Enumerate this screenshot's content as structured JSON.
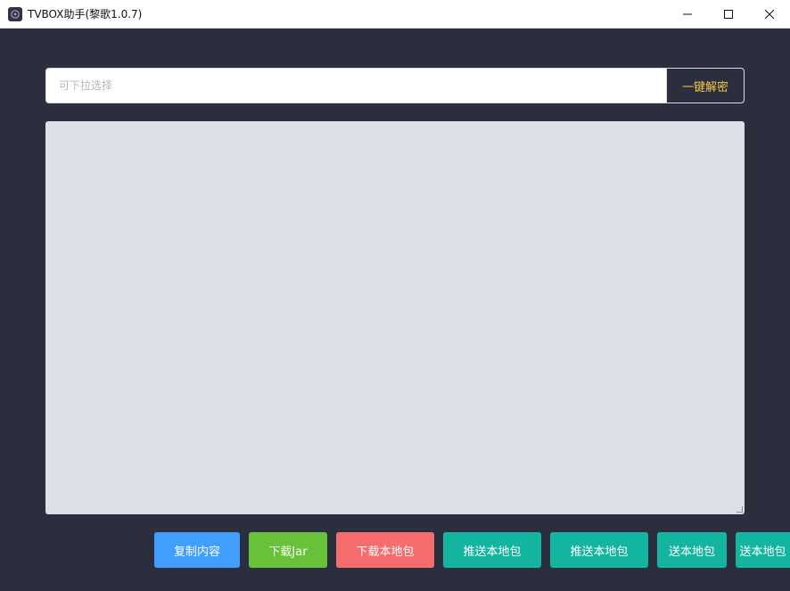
{
  "window": {
    "title": "TVBOX助手(黎歌1.0.7)",
    "controls": [
      "minimize",
      "maximize",
      "close"
    ]
  },
  "search": {
    "placeholder": "可下拉选择",
    "value": "",
    "decrypt_label": "一键解密"
  },
  "content": {
    "text": ""
  },
  "buttons": {
    "copy": "复制内容",
    "download_jar": "下载Jar",
    "download_local": "下载本地包",
    "push_local_1": "推送本地包",
    "push_local_2": "推送本地包",
    "push_local_3": "送本地包",
    "push_local_4": "送本地包"
  },
  "colors": {
    "background": "#2b2f3d",
    "content_area": "#dcdfe6",
    "accent_text": "#f2c94c",
    "blue": "#409eff",
    "green": "#67c23a",
    "red": "#f56c6c",
    "teal": "#13b5a0"
  }
}
